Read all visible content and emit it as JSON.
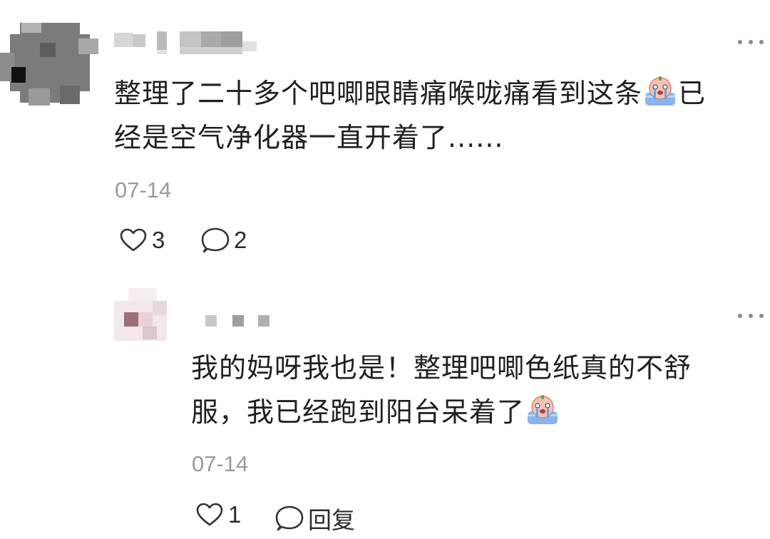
{
  "comments": [
    {
      "text_line1": "整理了二十多个吧唧眼睛痛喉咙痛看到这条",
      "text_line2_tail": "已",
      "text_line2": "经是空气净化器一直开着了......",
      "emoji": "crying-emoji",
      "date": "07-14",
      "likes": "3",
      "comments": "2"
    }
  ],
  "reply": {
    "text_line1": "我的妈呀我也是！整理吧唧色纸真的不舒",
    "text_line2": "服，我已经跑到阳台呆着了",
    "emoji": "crying-emoji",
    "date": "07-14",
    "likes": "1",
    "reply_label": "回复"
  },
  "icons": {
    "like": "heart-outline-icon",
    "comment": "speech-bubble-icon",
    "more": "ellipsis-icon"
  },
  "colors": {
    "text": "#1f1f1f",
    "meta": "#9a9a9a",
    "icon": "#333333"
  }
}
